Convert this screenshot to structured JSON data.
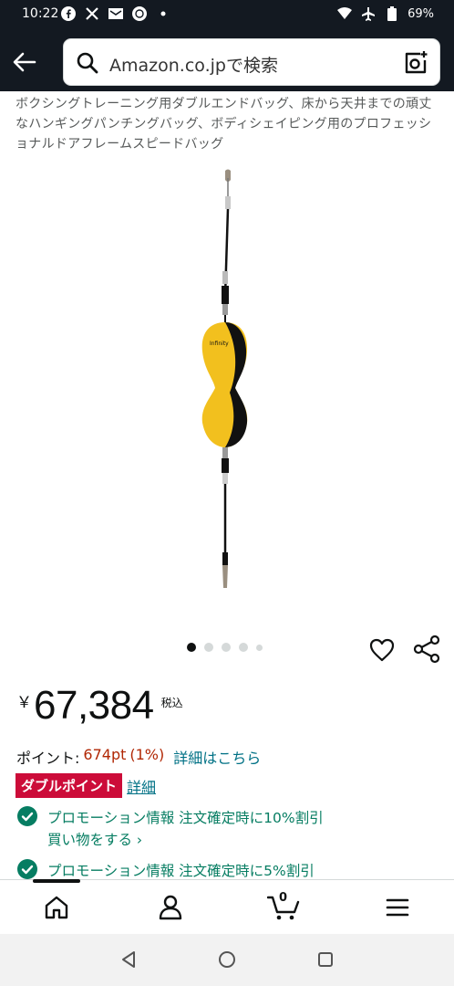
{
  "status_bar": {
    "time": "10:22",
    "battery": "69%",
    "left_icons": [
      "facebook-icon",
      "x-icon",
      "mail-icon",
      "app-icon",
      "dot-icon"
    ],
    "right_icons": [
      "wifi-icon",
      "airplane-icon",
      "battery-icon"
    ]
  },
  "header": {
    "search_placeholder": "Amazon.co.jpで検索"
  },
  "product": {
    "title": "ボクシングトレーニング用ダブルエンドバッグ、床から天井までの頑丈なハンギングパンチングバッグ、ボディシェイピング用のプロフェッショナルドアフレームスピードバッグ",
    "image_count": 5,
    "active_image": 0,
    "colors": {
      "bag": "#f2c01e",
      "band": "#111111"
    }
  },
  "price": {
    "symbol": "￥",
    "value": "67,384",
    "tax_label": "税込"
  },
  "points": {
    "label": "ポイント:",
    "value": "674pt",
    "percent": "(1%)",
    "details_link": "詳細はこちら",
    "double_badge": "ダブルポイント",
    "double_link": "詳細"
  },
  "promotions": [
    {
      "text": "プロモーション情報 注文確定時に10%割引",
      "link": "買い物をする ›"
    },
    {
      "text": "プロモーション情報 注文確定時に5%割引"
    }
  ],
  "bottom_nav": {
    "items": [
      "home-icon",
      "account-icon",
      "cart-icon",
      "menu-icon"
    ],
    "cart_count": "0"
  },
  "colors": {
    "header_bg": "#131921",
    "price_red": "#b12704",
    "link": "#007185",
    "promo_green": "#067d62",
    "badge_red": "#cc0c39"
  }
}
